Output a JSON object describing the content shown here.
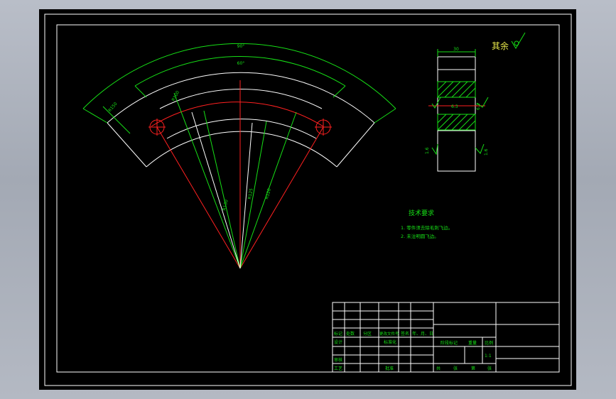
{
  "drawing": {
    "dimensions": {
      "outer_angle": "90°",
      "inner_angle": "60°",
      "r_outer": "R150",
      "r_right_slot": "R120",
      "r_center_slot": "R125",
      "r_inner": "R130",
      "r_top_slot": "R100",
      "width_top": "30",
      "side_upper": "6.3",
      "side_upper_right": "6.3",
      "side_left_low": "1.6",
      "side_right_low": "1.6"
    },
    "surface_note": "其余",
    "tech_requirements": {
      "title": "技术要求",
      "items": [
        "1. 零件须去除毛刺飞边。",
        "2. 未注明圆飞边。"
      ]
    },
    "title_block": {
      "row_labels": [
        "标记",
        "处数",
        "分区",
        "更改文件号",
        "签名",
        "年、月、日"
      ],
      "design": "设计",
      "standardization": "标准化",
      "review": "审核",
      "process": "工艺",
      "approve": "批准",
      "stage_mark": "阶段标记",
      "weight": "重量",
      "scale": "比例",
      "scale_value": "1:1",
      "sheets": [
        "共",
        "张",
        "第",
        "张"
      ]
    },
    "colors": {
      "green": "#16e016",
      "white": "#ffffff",
      "red": "#ff2020"
    }
  }
}
